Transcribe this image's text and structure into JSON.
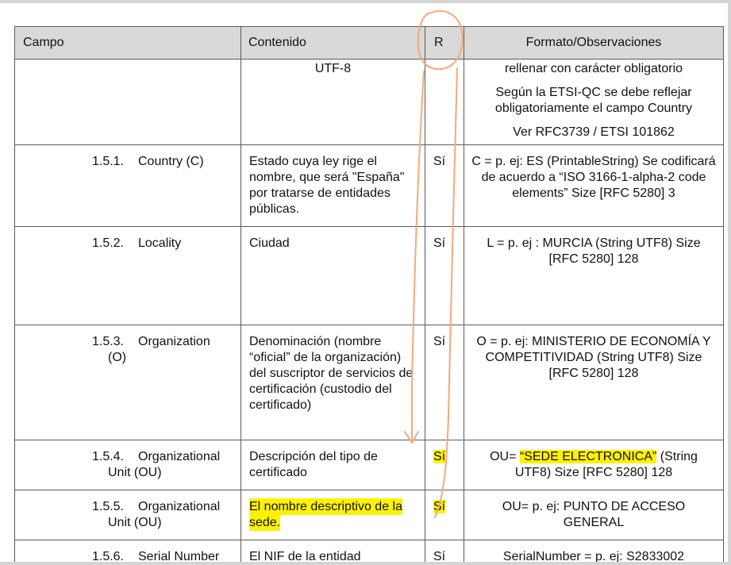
{
  "header": {
    "campo": "Campo",
    "contenido": "Contenido",
    "r": "R",
    "formato": "Formato/Observaciones"
  },
  "row0": {
    "contenido": "UTF-8",
    "formato_1": "rellenar con carácter obligatorio",
    "formato_2": "Según la ETSI-QC se debe reflejar obligatoriamente el campo Country",
    "formato_3": "Ver RFC3739 / ETSI 101862"
  },
  "rows": [
    {
      "num": "1.5.1.",
      "name": "Country (C)",
      "name2": "",
      "contenido": "Estado cuya ley rige el nombre, que será \"España\" por tratarse de entidades públicas.",
      "r": "Sí",
      "formato": "C = p. ej: ES (PrintableString) Se codificará de acuerdo a “ISO 3166-1-alpha-2 code elements” Size [RFC 5280] 3"
    },
    {
      "num": "1.5.2.",
      "name": "Locality",
      "name2": "",
      "contenido": "Ciudad",
      "r": "Sí",
      "formato": "L = p. ej : MURCIA (String UTF8) Size [RFC 5280] 128"
    },
    {
      "num": "1.5.3.",
      "name": "Organization",
      "name2": "(O)",
      "contenido": "Denominación (nombre “oficial” de la organización) del suscriptor de servicios de certificación (custodio del certificado)",
      "r": "Sí",
      "formato": "O = p. ej: MINISTERIO DE ECONOMÍA Y COMPETITIVIDAD (String UTF8) Size [RFC 5280] 128"
    },
    {
      "num": "1.5.4.",
      "name": "Organizational",
      "name2": "Unit (OU)",
      "contenido": "Descripción del tipo de certificado",
      "r": "Sí",
      "formato_pre": "OU= ",
      "formato_hl": "“SEDE ELECTRONICA”",
      "formato_post": " (String UTF8) Size [RFC 5280] 128"
    },
    {
      "num": "1.5.5.",
      "name": "Organizational",
      "name2": "Unit (OU)",
      "contenido": "El nombre descriptivo de la sede.",
      "r": "Sí",
      "formato": "OU= p. ej: PUNTO DE ACCESO GENERAL"
    },
    {
      "num": "1.5.6.",
      "name": "Serial Number",
      "name2": "",
      "contenido": "El NIF de la entidad",
      "r": "Sí",
      "formato": "SerialNumber = p. ej: S2833002"
    }
  ],
  "colors": {
    "highlight": "#fff200",
    "ink": "#f4a87a",
    "header_bg": "#d9d9d9"
  }
}
